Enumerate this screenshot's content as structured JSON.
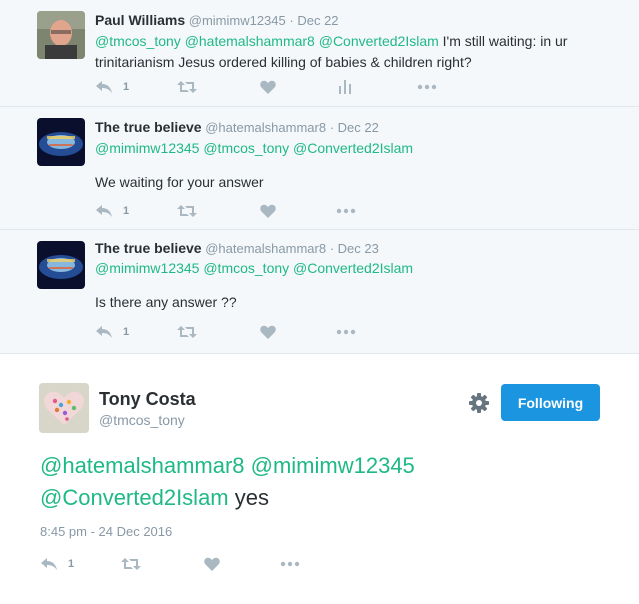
{
  "tweets": [
    {
      "name": "Paul Williams",
      "handle": "@mimimw12345",
      "dot": "·",
      "date": "Dec 22",
      "mentions": "@tmcos_tony @hatemalshammar8 @Converted2Islam",
      "text": "I'm still waiting: in ur trinitarianism Jesus ordered killing of babies & children right?",
      "reply_count": "1"
    },
    {
      "name": "The true believe",
      "handle": "@hatemalshammar8",
      "dot": "·",
      "date": "Dec 22",
      "mentions": "@mimimw12345 @tmcos_tony @Converted2Islam",
      "text": "We waiting for your answer",
      "reply_count": "1"
    },
    {
      "name": "The true believe",
      "handle": "@hatemalshammar8",
      "dot": "·",
      "date": "Dec 23",
      "mentions": "@mimimw12345 @tmcos_tony @Converted2Islam",
      "text": "Is there any answer ??",
      "reply_count": "1"
    }
  ],
  "main": {
    "name": "Tony Costa",
    "handle": "@tmcos_tony",
    "follow_label": "Following",
    "mention_line1": "@hatemalshammar8 @mimimw12345",
    "mention_line2": "@Converted2Islam",
    "text": "yes",
    "timestamp": "8:45 pm - 24 Dec 2016",
    "reply_count": "1"
  },
  "colors": {
    "mention": "#1fb985",
    "follow_button": "#1b95e0",
    "reply_background": "#f5f8fa",
    "muted": "#8899a6"
  }
}
